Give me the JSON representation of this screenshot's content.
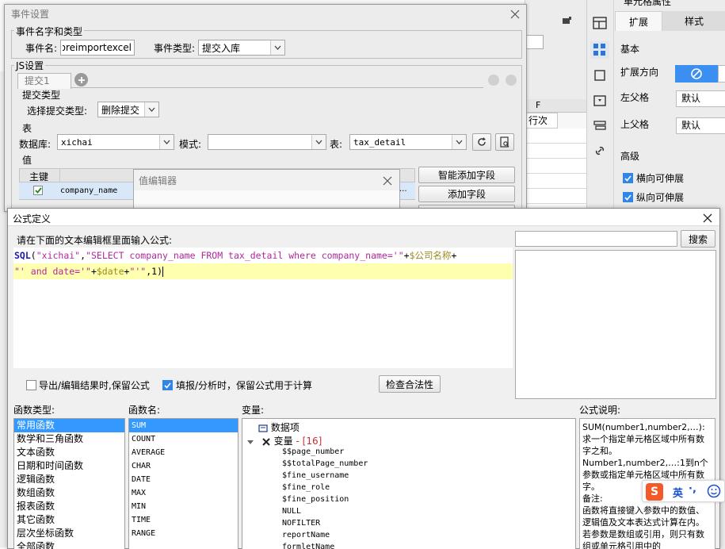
{
  "right_panel": {
    "title": "单元格属性",
    "tab_expand": "扩展",
    "tab_style": "样式",
    "section_basic": "基本",
    "expand_dir_label": "扩展方向",
    "left_parent_label": "左父格",
    "left_parent_value": "默认",
    "upper_parent_label": "上父格",
    "upper_parent_value": "默认",
    "section_advanced": "高级",
    "h_expand_label": "横向可伸展",
    "v_expand_label": "纵向可伸展"
  },
  "sheet": {
    "col_f": "F",
    "cell_hangci": "行次"
  },
  "event_dialog": {
    "title": "事件设置",
    "group_name_type": "事件名字和类型",
    "event_name_label": "事件名:",
    "event_name_value": "foreimportexcel",
    "event_type_label": "事件类型:",
    "event_type_value": "提交入库",
    "group_js": "JS设置",
    "tab_submit": "提交1",
    "submit_type_group": "提交类型",
    "select_submit_type_label": "选择提交类型:",
    "submit_type_value": "删除提交",
    "table_group": "表",
    "db_label": "数据库:",
    "db_value": "xichai",
    "mode_label": "模式:",
    "mode_value": "",
    "table_label": "表:",
    "table_value": "tax_detail",
    "value_group": "值",
    "col_primary_key": "主键",
    "row_field": "company_name",
    "row_more": "...",
    "smart_add_button": "智能添加字段",
    "add_field_button": "添加字段"
  },
  "value_editor": {
    "title": "值编辑器"
  },
  "formula_dialog": {
    "title": "公式定义",
    "prompt": "请在下面的文本编辑框里面输入公式:",
    "formula_line1": {
      "fn": "SQL",
      "open": "(",
      "str1": "\"xichai\"",
      "comma1": ",",
      "str2": "\"SELECT company_name FROM tax_detail where company_name='\"",
      "plus1": "+",
      "var1": "$公司名称",
      "plus2": "+"
    },
    "formula_line2": {
      "str3": "\"' and date='\"",
      "plus3": "+",
      "var2": "$date",
      "plus4": "+",
      "str4": "\"'\"",
      "tail": ",1)"
    },
    "search_placeholder": "",
    "search_button": "搜索",
    "keep_formula_export_label": "导出/编辑结果时,保留公式",
    "keep_formula_fill_label": "填报/分析时，保留公式用于计算",
    "check_validity_button": "检查合法性",
    "func_type_label": "函数类型:",
    "func_name_label": "函数名:",
    "variable_label": "变量:",
    "description_label": "公式说明:",
    "func_types": [
      "常用函数",
      "数学和三角函数",
      "文本函数",
      "日期和时间函数",
      "逻辑函数",
      "数组函数",
      "报表函数",
      "其它函数",
      "层次坐标函数",
      "全部函数"
    ],
    "func_names": [
      "SUM",
      "COUNT",
      "AVERAGE",
      "CHAR",
      "DATE",
      "MAX",
      "MIN",
      "TIME",
      "RANGE"
    ],
    "tree_data_item": "数据项",
    "tree_variables": "变量",
    "tree_variables_count": " - [16]",
    "variables": [
      "$$page_number",
      "$$totalPage_number",
      "$fine_username",
      "$fine_role",
      "$fine_position",
      "NULL",
      "NOFILTER",
      "reportName",
      "formletName"
    ],
    "description_text": "SUM(number1,number2,…):求一个指定单元格区域中所有数字之和。\nNumber1,number2,…:1到n个参数或指定单元格区域中所有数字。\n备注:\n函数将直接键入参数中的数值、逻辑值及文本表达式计算在内。若参数是数组或引用，则只有数组或单元格引用中的"
  },
  "ime": {
    "lang": "英",
    "punct": "·,"
  },
  "colors": {
    "accent": "#3399ff",
    "keyword_blue": "#1a1aa8",
    "string_purple": "#b0299a",
    "variable_olive": "#9a8a1a",
    "highlight_yellow": "#ffffb0"
  }
}
